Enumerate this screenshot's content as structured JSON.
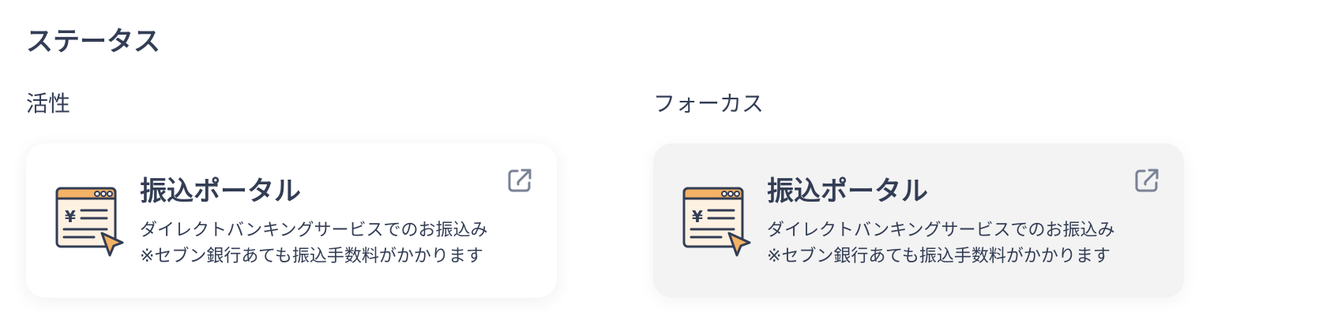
{
  "section": {
    "title": "ステータス"
  },
  "states": [
    {
      "label": "活性",
      "card": {
        "title": "振込ポータル",
        "description_line1": "ダイレクトバンキングサービスでのお振込み",
        "description_line2": "※セブン銀行あても振込手数料がかかります",
        "icon": "transfer-window-yen-cursor-icon",
        "link_icon": "external-link-icon"
      }
    },
    {
      "label": "フォーカス",
      "card": {
        "title": "振込ポータル",
        "description_line1": "ダイレクトバンキングサービスでのお振込み",
        "description_line2": "※セブン銀行あても振込手数料がかかります",
        "icon": "transfer-window-yen-cursor-icon",
        "link_icon": "external-link-icon"
      }
    }
  ],
  "colors": {
    "text": "#333d55",
    "icon_header": "#f4b266",
    "icon_body": "#fdf1e2",
    "cursor": "#f4b266",
    "focus_background": "#f3f3f3",
    "external_icon": "#7a8296"
  }
}
